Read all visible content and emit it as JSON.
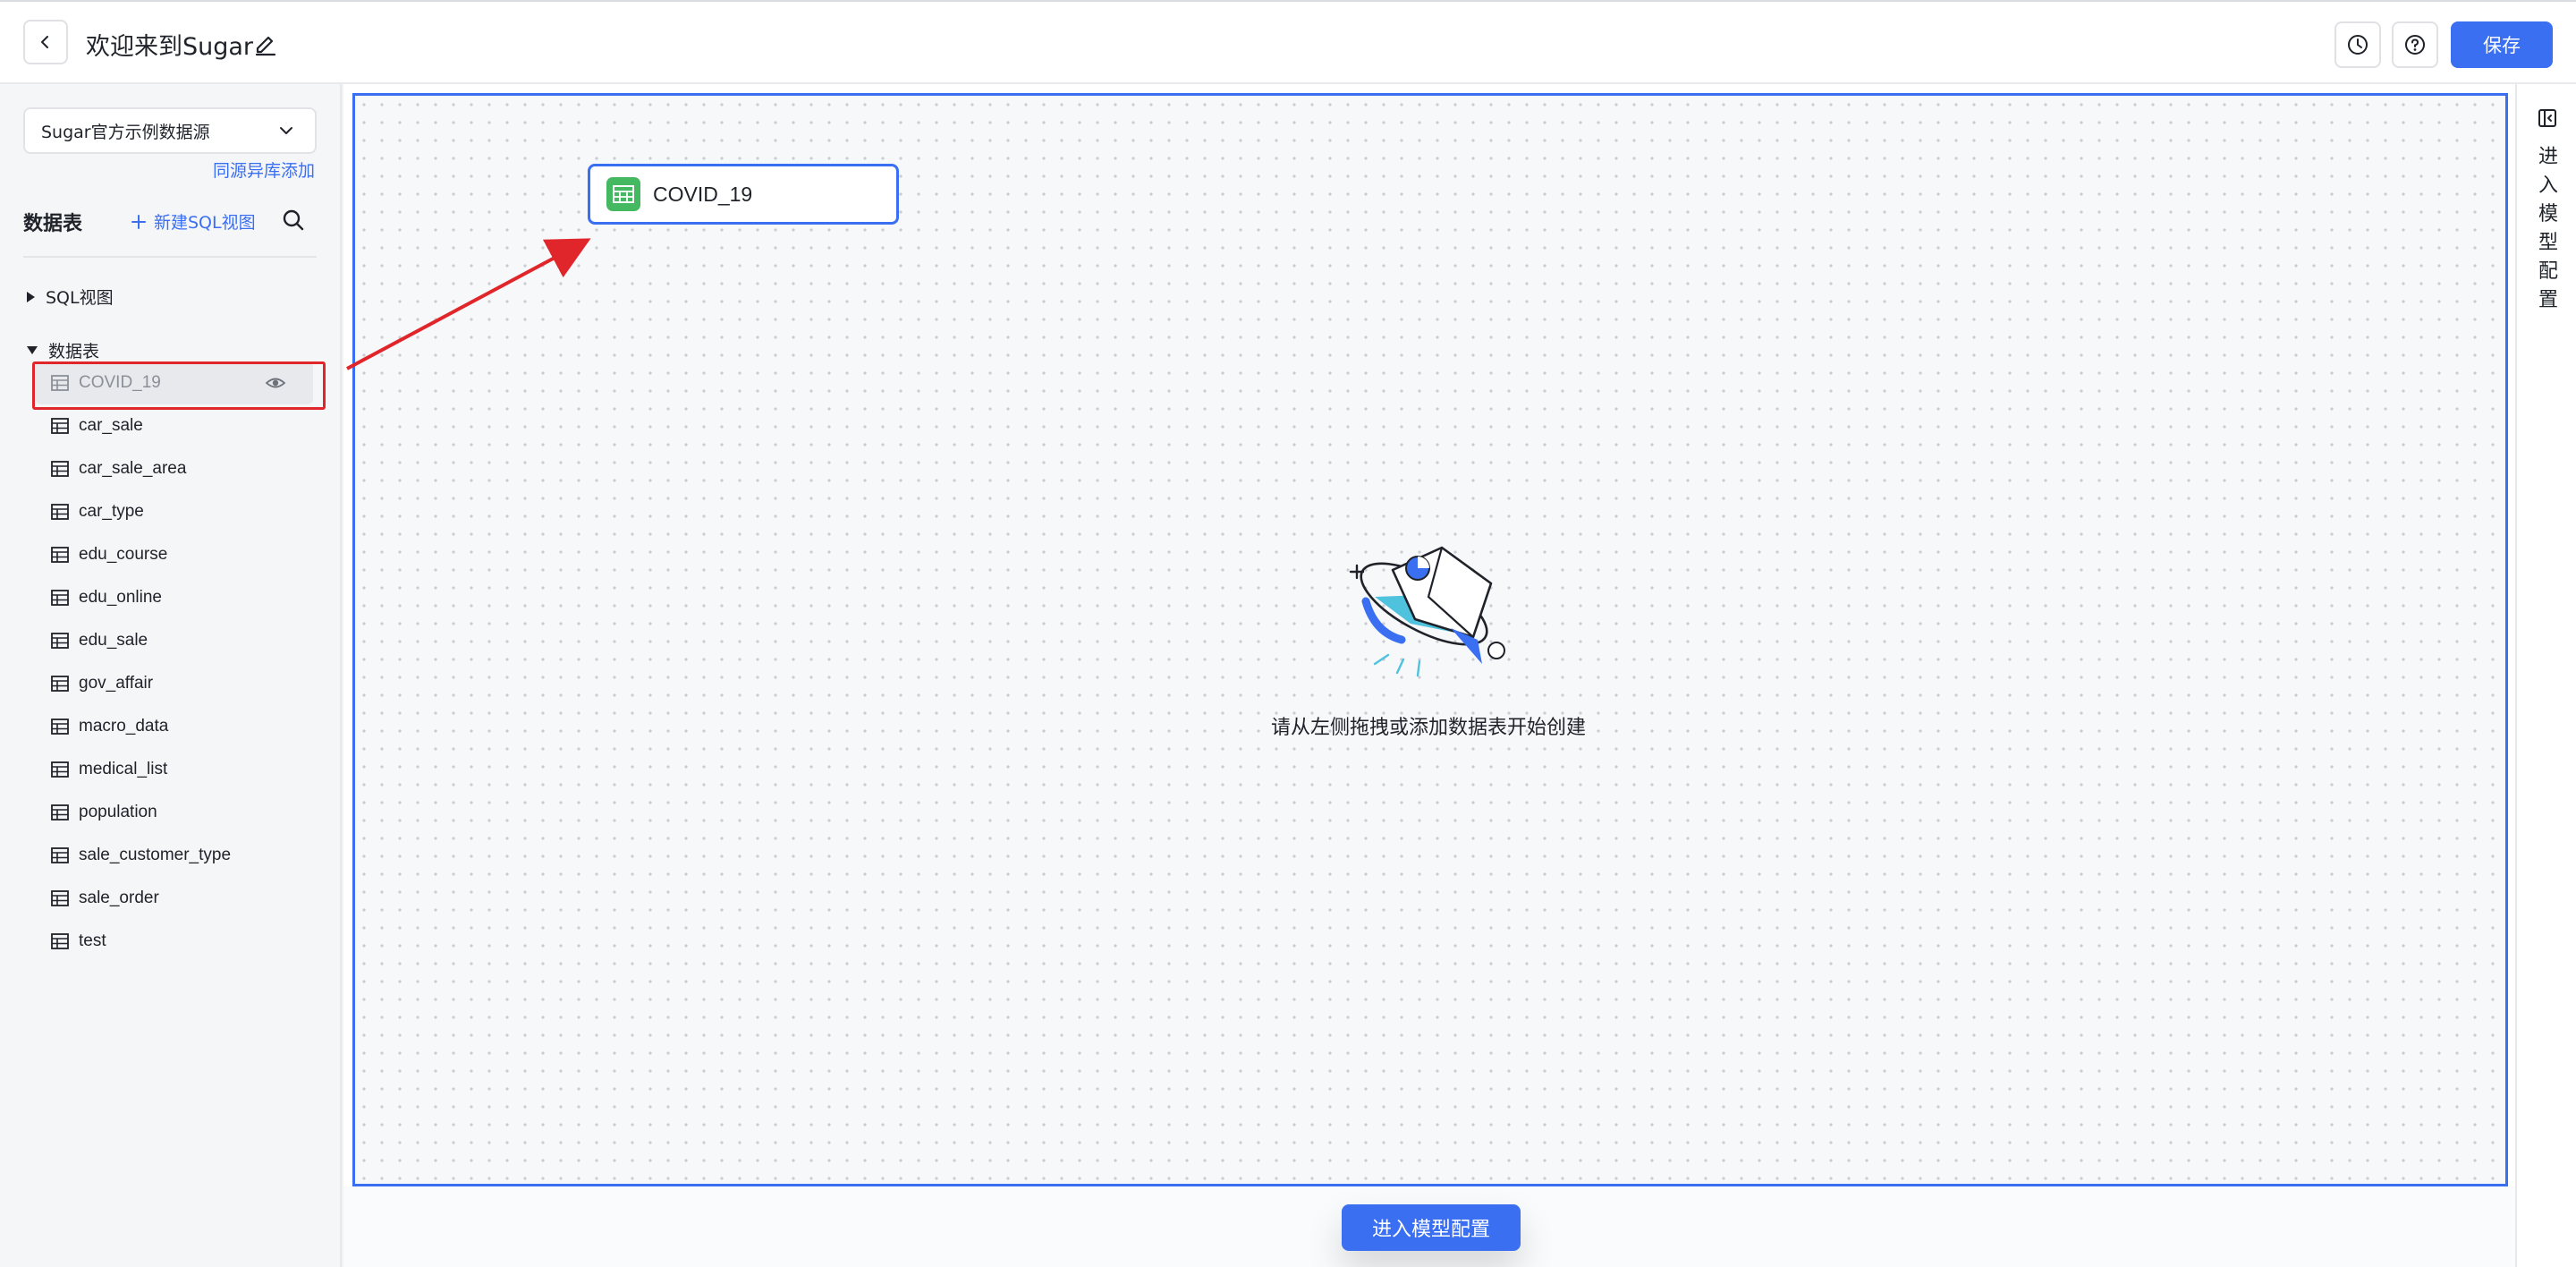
{
  "header": {
    "title": "欢迎来到Sugar",
    "save_label": "保存",
    "icons": [
      "back-icon",
      "edit-icon",
      "history-icon",
      "help-icon"
    ]
  },
  "sidebar": {
    "datasource_value": "Sugar官方示例数据源",
    "same_source_link": "同源异库添加",
    "section_title": "数据表",
    "new_sql_view": "新建SQL视图",
    "groups": {
      "sql_view": "SQL视图",
      "tables": "数据表"
    },
    "tables": [
      {
        "label": "COVID_19",
        "state": "dragging"
      },
      {
        "label": "car_sale"
      },
      {
        "label": "car_sale_area"
      },
      {
        "label": "car_type"
      },
      {
        "label": "edu_course"
      },
      {
        "label": "edu_online"
      },
      {
        "label": "edu_sale"
      },
      {
        "label": "gov_affair"
      },
      {
        "label": "macro_data"
      },
      {
        "label": "medical_list"
      },
      {
        "label": "population"
      },
      {
        "label": "sale_customer_type"
      },
      {
        "label": "sale_order"
      },
      {
        "label": "test"
      }
    ]
  },
  "canvas": {
    "node_label": "COVID_19",
    "empty_text": "请从左侧拖拽或添加数据表开始创建",
    "enter_button": "进入模型配置"
  },
  "right_rail": {
    "label": "进入模型配置"
  },
  "colors": {
    "accent": "#3a6ff2",
    "annotation": "#e0262b",
    "table_icon_green": "#45b862"
  }
}
